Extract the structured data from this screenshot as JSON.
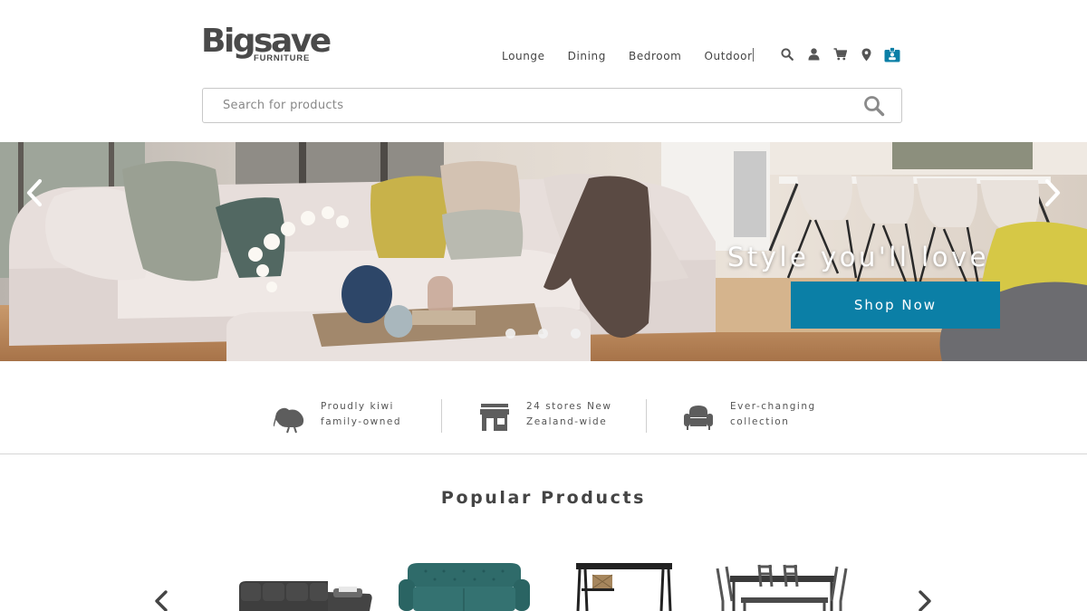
{
  "brand": {
    "name": "Bigsave",
    "sub": "FURNITURE"
  },
  "nav": {
    "links": [
      "Lounge",
      "Dining",
      "Bedroom",
      "Outdoor"
    ],
    "icons": [
      "search-icon",
      "user-icon",
      "cart-icon",
      "location-pin-icon",
      "id-badge-icon"
    ]
  },
  "search": {
    "placeholder": "Search for products",
    "value": ""
  },
  "hero": {
    "title": "Style you'll love",
    "cta": "Shop Now",
    "slides": 3,
    "active_slide": 1,
    "accent": "#0b7fa6"
  },
  "features": [
    {
      "icon": "kiwi-bird-icon",
      "text": "Proudly kiwi family-owned"
    },
    {
      "icon": "store-icon",
      "text": "24 stores New Zealand-wide"
    },
    {
      "icon": "armchair-icon",
      "text": "Ever-changing collection"
    }
  ],
  "popular": {
    "title": "Popular Products",
    "products": [
      {
        "icon": "sectional-sofa-icon"
      },
      {
        "icon": "teal-sofa-icon"
      },
      {
        "icon": "console-table-icon"
      },
      {
        "icon": "dining-set-icon"
      }
    ]
  }
}
